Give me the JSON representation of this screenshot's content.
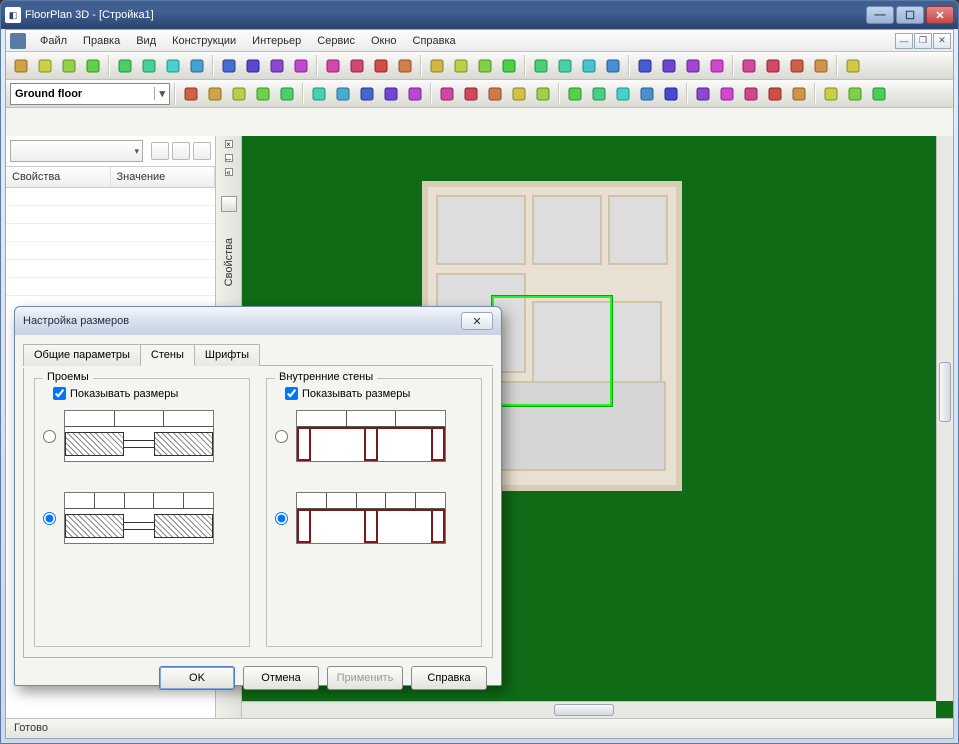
{
  "window": {
    "title": "FloorPlan 3D - [Стройка1]",
    "min": "—",
    "max": "☐",
    "close": "✕"
  },
  "menu": {
    "items": [
      "Файл",
      "Правка",
      "Вид",
      "Конструкции",
      "Интерьер",
      "Сервис",
      "Окно",
      "Справка"
    ]
  },
  "mdi": {
    "min": "—",
    "restore": "❐",
    "close": "✕"
  },
  "floor_selector": {
    "value": "Ground floor"
  },
  "side": {
    "col1": "Свойства",
    "col2": "Значение",
    "vtab": "Свойства"
  },
  "status": {
    "text": "Готово"
  },
  "dialog": {
    "title": "Настройка размеров",
    "close_glyph": "✕",
    "tabs": [
      "Общие параметры",
      "Стены",
      "Шрифты"
    ],
    "active_tab": 1,
    "left": {
      "legend": "Проемы",
      "check": "Показывать размеры"
    },
    "right": {
      "legend": "Внутренние стены",
      "check": "Показывать размеры"
    },
    "buttons": {
      "ok": "OK",
      "cancel": "Отмена",
      "apply": "Применить",
      "help": "Справка"
    }
  },
  "toolbar_icons_row1": [
    "new",
    "open",
    "save",
    "print",
    "copy",
    "paste",
    "undo",
    "redo",
    "help",
    "zoom-in",
    "zoom-out",
    "zoom-fit",
    "zoom-window",
    "zoom-prev",
    "pan",
    "cursor3d",
    "dims",
    "text",
    "fill",
    "color1",
    "color2",
    "grid",
    "layers",
    "tool1",
    "align-left",
    "align-center",
    "align-right",
    "align-top",
    "align-middle",
    "align-bottom",
    "plus",
    "plus2",
    "plus3"
  ],
  "toolbar_icons_row2": [
    "select",
    "wall",
    "door",
    "window",
    "roof",
    "stairs",
    "column",
    "beam",
    "dim",
    "camera",
    "furn1",
    "furn2",
    "furn3",
    "furn4",
    "furn5",
    "furn6",
    "furn7",
    "furn8",
    "tree",
    "fence",
    "ground",
    "road",
    "3d",
    "house",
    "roof3d",
    "edit",
    "folder",
    "misc"
  ]
}
